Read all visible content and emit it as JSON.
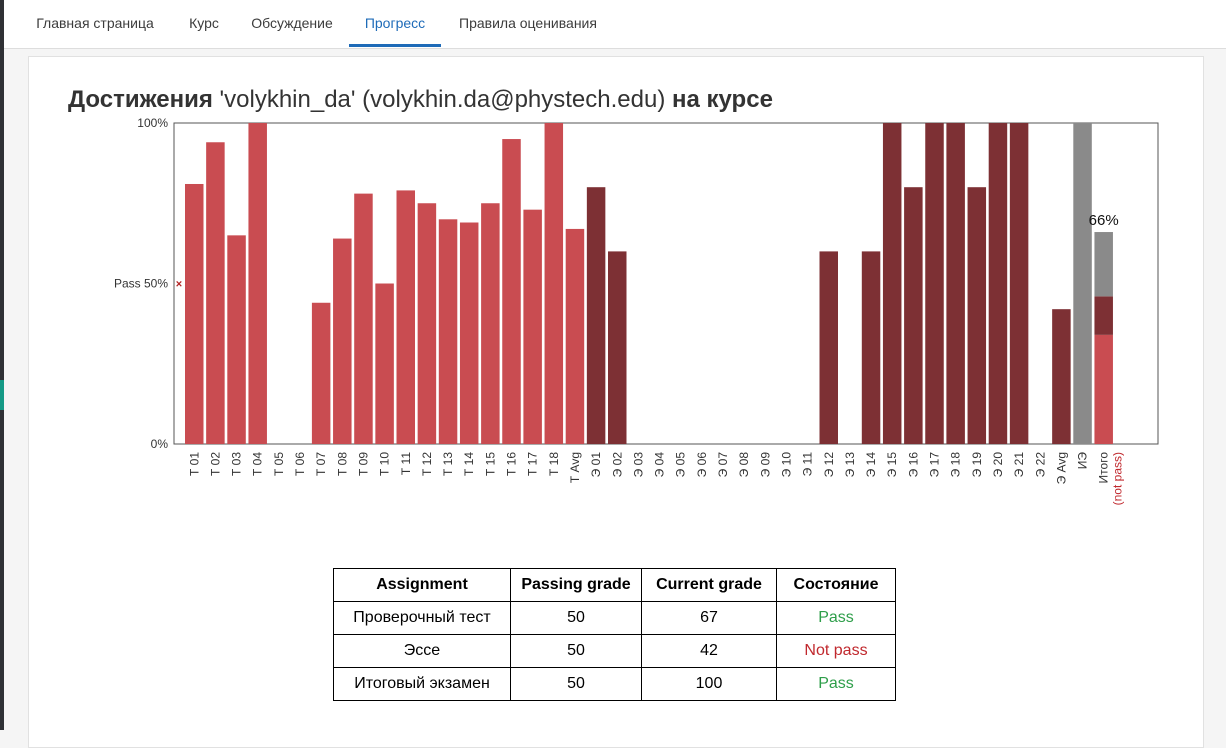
{
  "tabs": [
    {
      "label": "Главная страница",
      "active": false
    },
    {
      "label": "Курс",
      "active": false
    },
    {
      "label": "Обсуждение",
      "active": false
    },
    {
      "label": "Прогресс",
      "active": true
    },
    {
      "label": "Правила оценивания",
      "active": false
    }
  ],
  "title": {
    "prefix": "Достижения",
    "user": " 'volykhin_da' (volykhin.da@phystech.edu) ",
    "suffix": "на курсе"
  },
  "chart_data": {
    "type": "bar",
    "ylim": [
      0,
      100
    ],
    "y_ticks": [
      {
        "value": 100,
        "label": "100%"
      },
      {
        "value": 50,
        "label": "Pass 50%"
      },
      {
        "value": 0,
        "label": "0%"
      }
    ],
    "pass_marker": {
      "value": 50,
      "symbol": "×",
      "color": "#b22222"
    },
    "colors": {
      "test": "#c94c51",
      "essay": "#7d3034",
      "exam": "#8a8a8a",
      "not_pass_label": "#c0282d"
    },
    "categories": [
      "Т 01",
      "Т 02",
      "Т 03",
      "Т 04",
      "Т 05",
      "Т 06",
      "Т 07",
      "Т 08",
      "Т 09",
      "Т 10",
      "Т 11",
      "Т 12",
      "Т 13",
      "Т 14",
      "Т 15",
      "Т 16",
      "Т 17",
      "Т 18",
      "Т Avg",
      "Э 01",
      "Э 02",
      "Э 03",
      "Э 04",
      "Э 05",
      "Э 06",
      "Э 07",
      "Э 08",
      "Э 09",
      "Э 10",
      "Э 11",
      "Э 12",
      "Э 13",
      "Э 14",
      "Э 15",
      "Э 16",
      "Э 17",
      "Э 18",
      "Э 19",
      "Э 20",
      "Э 21",
      "Э 22",
      "Э Avg",
      "ИЭ",
      "Итого"
    ],
    "values": [
      81,
      94,
      65,
      100,
      0,
      0,
      44,
      64,
      78,
      50,
      79,
      75,
      70,
      69,
      75,
      95,
      73,
      100,
      67,
      80,
      60,
      0,
      0,
      0,
      0,
      0,
      0,
      0,
      0,
      0,
      60,
      0,
      60,
      100,
      80,
      100,
      100,
      80,
      100,
      100,
      0,
      42,
      100,
      66
    ],
    "groups": [
      "test",
      "test",
      "test",
      "test",
      "test",
      "test",
      "test",
      "test",
      "test",
      "test",
      "test",
      "test",
      "test",
      "test",
      "test",
      "test",
      "test",
      "test",
      "test",
      "essay",
      "essay",
      "essay",
      "essay",
      "essay",
      "essay",
      "essay",
      "essay",
      "essay",
      "essay",
      "essay",
      "essay",
      "essay",
      "essay",
      "essay",
      "essay",
      "essay",
      "essay",
      "essay",
      "essay",
      "essay",
      "essay",
      "essay",
      "exam",
      "total"
    ],
    "total": {
      "label": "66%",
      "value": 66,
      "stack": [
        {
          "group": "test",
          "value": 34
        },
        {
          "group": "essay",
          "value": 12
        },
        {
          "group": "exam",
          "value": 20
        }
      ],
      "status_label": "(not pass)"
    }
  },
  "table": {
    "headers": [
      "Assignment",
      "Passing grade",
      "Current grade",
      "Состояние"
    ],
    "rows": [
      {
        "assignment": "Проверочный тест",
        "passing": "50",
        "current": "67",
        "status": "Pass",
        "pass": true
      },
      {
        "assignment": "Эссе",
        "passing": "50",
        "current": "42",
        "status": "Not pass",
        "pass": false
      },
      {
        "assignment": "Итоговый экзамен",
        "passing": "50",
        "current": "100",
        "status": "Pass",
        "pass": true
      }
    ]
  }
}
